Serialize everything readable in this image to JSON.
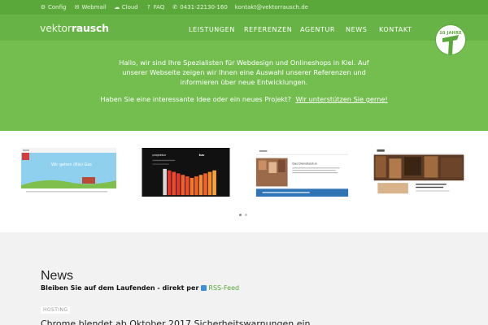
{
  "topbar": {
    "links": [
      {
        "icon": "gear-icon",
        "glyph": "⚙",
        "label": "Config"
      },
      {
        "icon": "envelope-icon",
        "glyph": "✉",
        "label": "Webmail"
      },
      {
        "icon": "cloud-icon",
        "glyph": "☁",
        "label": "Cloud"
      },
      {
        "icon": "question-icon",
        "glyph": "?",
        "label": "FAQ"
      },
      {
        "icon": "phone-icon",
        "glyph": "✆",
        "label": "0431-22130-160"
      },
      {
        "icon": "",
        "glyph": "",
        "label": "kontakt@vektorrausch.de"
      }
    ]
  },
  "header": {
    "logo_a": "vektor",
    "logo_b": "rausch",
    "nav": [
      "LEISTUNGEN",
      "REFERENZEN",
      "AGENTUR",
      "NEWS",
      "KONTAKT"
    ],
    "badge": "10 JAHRE"
  },
  "hero": {
    "intro": "Hallo, wir sind Ihre Spezialisten für Webdesign und Onlineshops in Kiel. Auf unserer Webseite zeigen wir Ihnen eine Auswahl unserer Referenzen und informieren über neue Entwicklungen.",
    "question": "Haben Sie eine interessante Idee oder ein neues Projekt?",
    "cta": "Wir unterstützen Sie gerne!"
  },
  "references": {
    "slides": 4,
    "thumb1_text": "Wir gehen (Bio) Gas",
    "thumb2_text": "projektor",
    "thumb3_text": "Das Dienstleistun"
  },
  "news": {
    "title": "News",
    "subtitle": "Bleiben Sie auf dem Laufenden - direkt per",
    "feed": "RSS-Feed",
    "tag": "HOSTING",
    "headline": "Chrome blendet ab Oktober 2017 Sicherheitswarnungen ein"
  },
  "colors": {
    "topbar": "#5aa83a",
    "header": "#67b345",
    "hero": "#74be50",
    "news_bg": "#f2f2f2",
    "accent": "#58a636"
  }
}
